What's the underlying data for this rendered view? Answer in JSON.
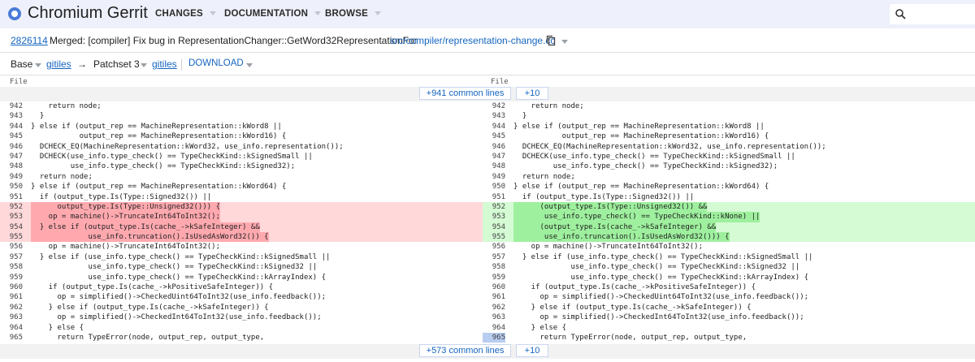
{
  "header": {
    "brand": "Chromium Gerrit",
    "nav": [
      "CHANGES",
      "DOCUMENTATION",
      "BROWSE"
    ]
  },
  "change": {
    "number": "2826114",
    "title": "Merged: [compiler] Fix bug in RepresentationChanger::GetWord32RepresentationFor",
    "file_path": "src/compiler/representation-change.cc"
  },
  "patchset": {
    "base_label": "Base",
    "base_link": "gitiles",
    "arrow": "→",
    "ps_label": "Patchset 3",
    "ps_link": "gitiles",
    "download": "DOWNLOAD"
  },
  "diff": {
    "file_label": "File",
    "common_top": "+941 common lines",
    "plus_top": "+10",
    "common_bottom": "+573 common lines",
    "plus_bottom": "+10",
    "left": [
      {
        "n": "942",
        "t": "    return node;"
      },
      {
        "n": "943",
        "t": "  }"
      },
      {
        "n": "944",
        "t": "} else if (output_rep == MachineRepresentation::kWord8 ||"
      },
      {
        "n": "945",
        "t": "           output_rep == MachineRepresentation::kWord16) {"
      },
      {
        "n": "946",
        "t": "  DCHECK_EQ(MachineRepresentation::kWord32, use_info.representation());"
      },
      {
        "n": "947",
        "t": "  DCHECK(use_info.type_check() == TypeCheckKind::kSignedSmall ||"
      },
      {
        "n": "948",
        "t": "         use_info.type_check() == TypeCheckKind::kSigned32);"
      },
      {
        "n": "949",
        "t": "  return node;"
      },
      {
        "n": "950",
        "t": "} else if (output_rep == MachineRepresentation::kWord64) {"
      },
      {
        "n": "951",
        "t": "  if (output_type.Is(Type::Signed32()) ||"
      },
      {
        "n": "952",
        "t": "      output_type.Is(Type::Unsigned32())) {",
        "k": "del"
      },
      {
        "n": "953",
        "t": "    op = machine()->TruncateInt64ToInt32();",
        "k": "del"
      },
      {
        "n": "954",
        "t": "  } else if (output_type.Is(cache_->kSafeInteger) &&",
        "k": "del"
      },
      {
        "n": "955",
        "t": "             use_info.truncation().IsUsedAsWord32()) {",
        "k": "del"
      },
      {
        "n": "956",
        "t": "    op = machine()->TruncateInt64ToInt32();"
      },
      {
        "n": "957",
        "t": "  } else if (use_info.type_check() == TypeCheckKind::kSignedSmall ||"
      },
      {
        "n": "958",
        "t": "             use_info.type_check() == TypeCheckKind::kSigned32 ||"
      },
      {
        "n": "959",
        "t": "             use_info.type_check() == TypeCheckKind::kArrayIndex) {"
      },
      {
        "n": "960",
        "t": "    if (output_type.Is(cache_->kPositiveSafeInteger)) {"
      },
      {
        "n": "961",
        "t": "      op = simplified()->CheckedUint64ToInt32(use_info.feedback());"
      },
      {
        "n": "962",
        "t": "    } else if (output_type.Is(cache_->kSafeInteger)) {"
      },
      {
        "n": "963",
        "t": "      op = simplified()->CheckedInt64ToInt32(use_info.feedback());"
      },
      {
        "n": "964",
        "t": "    } else {"
      },
      {
        "n": "965",
        "t": "      return TypeError(node, output_rep, output_type,"
      }
    ],
    "right": [
      {
        "n": "942",
        "t": "    return node;"
      },
      {
        "n": "943",
        "t": "  }"
      },
      {
        "n": "944",
        "t": "} else if (output_rep == MachineRepresentation::kWord8 ||"
      },
      {
        "n": "945",
        "t": "           output_rep == MachineRepresentation::kWord16) {"
      },
      {
        "n": "946",
        "t": "  DCHECK_EQ(MachineRepresentation::kWord32, use_info.representation());"
      },
      {
        "n": "947",
        "t": "  DCHECK(use_info.type_check() == TypeCheckKind::kSignedSmall ||"
      },
      {
        "n": "948",
        "t": "         use_info.type_check() == TypeCheckKind::kSigned32);"
      },
      {
        "n": "949",
        "t": "  return node;"
      },
      {
        "n": "950",
        "t": "} else if (output_rep == MachineRepresentation::kWord64) {"
      },
      {
        "n": "951",
        "t": "  if (output_type.Is(Type::Signed32()) ||"
      },
      {
        "n": "952",
        "t": "      (output_type.Is(Type::Unsigned32()) &&",
        "k": "add"
      },
      {
        "n": "953",
        "t": "       use_info.type_check() == TypeCheckKind::kNone) ||",
        "k": "add"
      },
      {
        "n": "954",
        "t": "      (output_type.Is(cache_->kSafeInteger) &&",
        "k": "add"
      },
      {
        "n": "955",
        "t": "       use_info.truncation().IsUsedAsWord32())) {",
        "k": "add"
      },
      {
        "n": "956",
        "t": "    op = machine()->TruncateInt64ToInt32();"
      },
      {
        "n": "957",
        "t": "  } else if (use_info.type_check() == TypeCheckKind::kSignedSmall ||"
      },
      {
        "n": "958",
        "t": "             use_info.type_check() == TypeCheckKind::kSigned32 ||"
      },
      {
        "n": "959",
        "t": "             use_info.type_check() == TypeCheckKind::kArrayIndex) {"
      },
      {
        "n": "960",
        "t": "    if (output_type.Is(cache_->kPositiveSafeInteger)) {"
      },
      {
        "n": "961",
        "t": "      op = simplified()->CheckedUint64ToInt32(use_info.feedback());"
      },
      {
        "n": "962",
        "t": "    } else if (output_type.Is(cache_->kSafeInteger)) {"
      },
      {
        "n": "963",
        "t": "      op = simplified()->CheckedInt64ToInt32(use_info.feedback());"
      },
      {
        "n": "964",
        "t": "    } else {"
      },
      {
        "n": "965",
        "t": "      return TypeError(node, output_rep, output_type,",
        "sel": true
      }
    ]
  }
}
